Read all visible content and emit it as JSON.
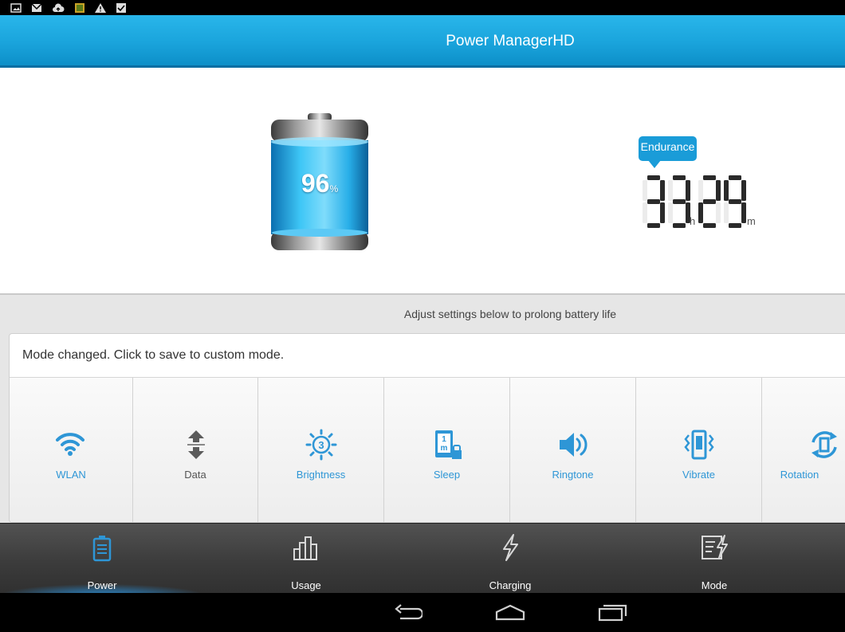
{
  "status_bar": {
    "icons": [
      "image-icon",
      "gmail-icon",
      "cloud-upload-icon",
      "app-notification-icon",
      "warning-icon",
      "checkbox-icon"
    ]
  },
  "app": {
    "title": "Power ManagerHD",
    "accent_color": "#1aa4dc"
  },
  "battery": {
    "level_value": "96",
    "level_unit": "%",
    "level_fraction": 0.96
  },
  "endurance": {
    "label": "Endurance",
    "hours": "33",
    "hours_unit": "h",
    "minutes": "29",
    "minutes_unit": "m"
  },
  "settings": {
    "hint": "Adjust settings below to prolong battery life",
    "mode_message": "Mode changed. Click to save to custom mode.",
    "toggles": [
      {
        "label": "WLAN",
        "icon": "wifi-icon",
        "active": true
      },
      {
        "label": "Data",
        "icon": "data-icon",
        "active": false
      },
      {
        "label": "Brightness",
        "icon": "brightness-icon",
        "active": true,
        "level": "3"
      },
      {
        "label": "Sleep",
        "icon": "sleep-icon",
        "active": true,
        "level": "1",
        "unit": "m"
      },
      {
        "label": "Ringtone",
        "icon": "speaker-icon",
        "active": true
      },
      {
        "label": "Vibrate",
        "icon": "vibrate-icon",
        "active": true
      },
      {
        "label": "Rotation",
        "icon": "rotation-icon",
        "active": true
      }
    ]
  },
  "bottom_nav": {
    "items": [
      {
        "label": "Power",
        "icon": "battery-icon",
        "selected": true
      },
      {
        "label": "Usage",
        "icon": "bar-chart-icon",
        "selected": false
      },
      {
        "label": "Charging",
        "icon": "lightning-icon",
        "selected": false
      },
      {
        "label": "Mode",
        "icon": "mode-icon",
        "selected": false
      }
    ]
  },
  "system_nav": {
    "buttons": [
      "back-icon",
      "home-icon",
      "recent-apps-icon"
    ]
  }
}
